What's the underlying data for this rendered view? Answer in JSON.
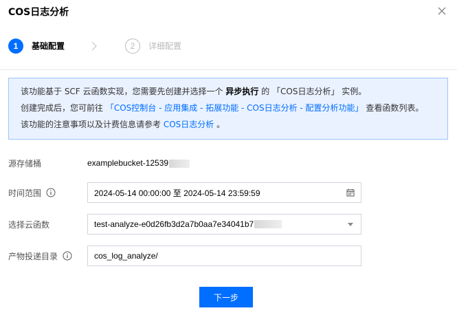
{
  "dialog": {
    "title": "COS日志分析"
  },
  "steps": [
    {
      "number": "1",
      "label": "基础配置",
      "state": "active"
    },
    {
      "number": "2",
      "label": "详细配置",
      "state": "inactive"
    }
  ],
  "notice": {
    "line1_prefix": "该功能基于 SCF 云函数实现，您需要先创建并选择一个 ",
    "line1_bold": "异步执行",
    "line1_mid": " 的 ",
    "line1_quoted": "「COS日志分析」",
    "line1_suffix": " 实例。",
    "line2_prefix": "创建完成后，您可前往 ",
    "line2_link": "「COS控制台 - 应用集成 - 拓展功能 - COS日志分析 - 配置分析功能」",
    "line2_suffix": " 查看函数列表。",
    "line3_prefix": "该功能的注意事项以及计费信息请参考 ",
    "line3_link": "COS日志分析",
    "line3_suffix": " 。"
  },
  "form": {
    "source_bucket": {
      "label": "源存储桶",
      "value": "examplebucket-12539"
    },
    "time_range": {
      "label": "时间范围",
      "value": "2024-05-14 00:00:00 至 2024-05-14 23:59:59"
    },
    "cloud_function": {
      "label": "选择云函数",
      "value": "test-analyze-e0d26fb3d2a7b0aa7e34041b7"
    },
    "output_dir": {
      "label": "产物投递目录",
      "value": "cos_log_analyze/"
    }
  },
  "footer": {
    "next_label": "下一步"
  },
  "colors": {
    "primary": "#006eff",
    "notice_bg": "#eaf2ff",
    "notice_border": "#9ac3ff"
  },
  "icons": {
    "close": "close-icon",
    "step_arrow": "chevron-right-icon",
    "info": "info-icon",
    "calendar": "calendar-icon",
    "dropdown": "caret-down-icon"
  }
}
